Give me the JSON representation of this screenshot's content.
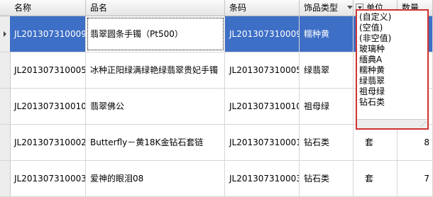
{
  "headers": {
    "name": "名称",
    "product": "品名",
    "barcode": "条码",
    "type": "饰品类型",
    "unit": "单位",
    "qty": "数量"
  },
  "rows": [
    {
      "name": "JL201307310009",
      "product": "翡翠圆条手镯（Pt500）",
      "barcode": "JL201307310009",
      "type": "糯种黄",
      "unit": "",
      "qty": ""
    },
    {
      "name": "JL201307310005",
      "product": "冰种正阳绿满绿艳绿翡翠贵妃手镯",
      "barcode": "JL201307310005",
      "type": "绿翡翠",
      "unit": "",
      "qty": ""
    },
    {
      "name": "JL201307310010",
      "product": "翡翠佛公",
      "barcode": "JL201307310010",
      "type": "祖母绿",
      "unit": "",
      "qty": ""
    },
    {
      "name": "JL201307310002",
      "product": "Butterfly－黄18K金钻石套链",
      "barcode": "JL201307310001",
      "type": "钻石类",
      "unit": "套",
      "qty": "8"
    },
    {
      "name": "JL201307310003",
      "product": "爱神的眼泪08",
      "barcode": "JL201307310003",
      "type": "钻石类",
      "unit": "套",
      "qty": "7"
    }
  ],
  "filter_options": [
    "(自定义)",
    "(空值)",
    "(非空值)",
    "玻璃种",
    "缅典A",
    "糯种黄",
    "绿翡翠",
    "祖母绿",
    "钻石类"
  ],
  "colors": {
    "selection": "#3e6fc6",
    "popup_border": "#d03232"
  }
}
